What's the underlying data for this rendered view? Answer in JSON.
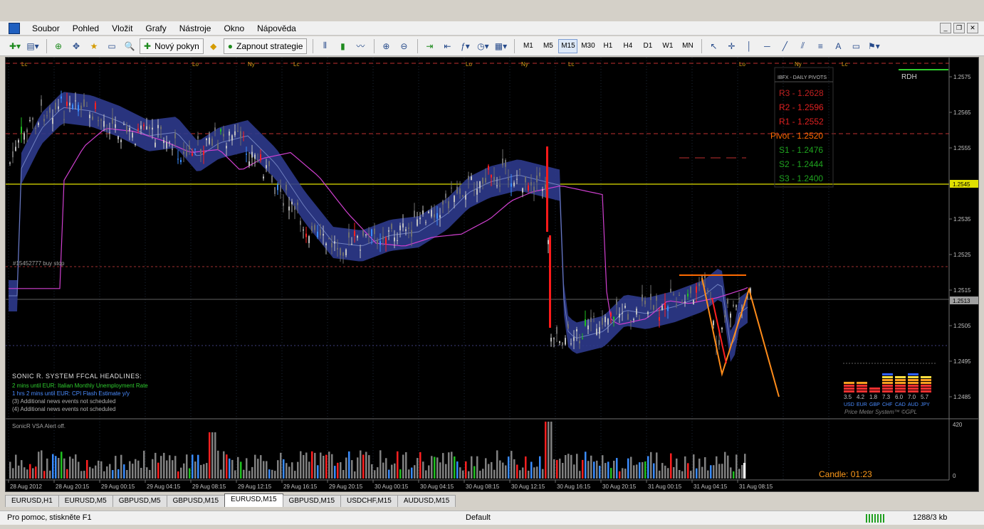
{
  "menu": {
    "items": [
      "Soubor",
      "Pohled",
      "Vložit",
      "Grafy",
      "Nástroje",
      "Okno",
      "Nápověda"
    ]
  },
  "toolbar": {
    "new_order_label": "Nový pokyn",
    "strategy_label": "Zapnout strategie",
    "timeframes": [
      "M1",
      "M5",
      "M15",
      "M30",
      "H1",
      "H4",
      "D1",
      "W1",
      "MN"
    ],
    "active_timeframe": "M15",
    "drawing_tools": [
      "A"
    ]
  },
  "chart": {
    "session_markers": [
      "Lc",
      "Lo",
      "Ny",
      "Lc",
      "Lo",
      "Ny",
      "Lc",
      "Lo",
      "Ny",
      "Lc"
    ],
    "order_label": "#15452777 buy stop",
    "current_price_line": "1.2545",
    "bid_price": "1.2513",
    "price_axis": [
      "1.2575",
      "1.2565",
      "1.2555",
      "1.2545",
      "1.2535",
      "1.2525",
      "1.2515",
      "1.2505",
      "1.2495",
      "1.2485"
    ],
    "time_axis": [
      "28 Aug 2012",
      "28 Aug 20:15",
      "29 Aug 00:15",
      "29 Aug 04:15",
      "29 Aug 08:15",
      "29 Aug 12:15",
      "29 Aug 16:15",
      "29 Aug 20:15",
      "30 Aug 00:15",
      "30 Aug 04:15",
      "30 Aug 08:15",
      "30 Aug 12:15",
      "30 Aug 16:15",
      "30 Aug 20:15",
      "31 Aug 00:15",
      "31 Aug 04:15",
      "31 Aug 08:15"
    ],
    "rdh_label": "RDH",
    "pivots_title": "IBFX - DAILY PIVOTS",
    "pivots": [
      {
        "label": "R3 - 1.2628",
        "color": "#c02020"
      },
      {
        "label": "R2 - 1.2596",
        "color": "#e02020"
      },
      {
        "label": "R1 - 1.2552",
        "color": "#e02020"
      },
      {
        "label": "Pivot - 1.2520",
        "color": "#ff6a00"
      },
      {
        "label": "S1 - 1.2476",
        "color": "#1fa31f"
      },
      {
        "label": "S2 - 1.2444",
        "color": "#1fa31f"
      },
      {
        "label": "S3 - 1.2400",
        "color": "#1fa31f"
      }
    ],
    "news_header": "SONIC R. SYSTEM  FFCAL HEADLINES:",
    "news": [
      {
        "text": "2 mins until EUR: Italian Monthly Unemployment Rate",
        "color": "#2ecc2e"
      },
      {
        "text": "1 hrs 2 mins until EUR: CPI Flash Estimate y/y",
        "color": "#4a8cff"
      },
      {
        "text": "(3)  Additional news events not scheduled",
        "color": "#b0b0b0"
      },
      {
        "text": "(4)  Additional news events not scheduled",
        "color": "#b0b0b0"
      }
    ],
    "price_meter": {
      "values": [
        "3.5",
        "4.2",
        "1.8",
        "7.3",
        "6.0",
        "7.0",
        "5.7"
      ],
      "currencies": [
        "USD",
        "EUR",
        "GBP",
        "CHF",
        "CAD",
        "AUD",
        "JPY"
      ],
      "caption": "Price Meter System™ ©GPL"
    }
  },
  "indicator": {
    "label": "SonicR VSA   Alert off.",
    "axis_top": "420",
    "axis_bottom": "0",
    "candle_timer": "Candle:  01:23"
  },
  "tabs": [
    "EURUSD,H1",
    "EURUSD,M5",
    "GBPUSD,M5",
    "GBPUSD,M15",
    "EURUSD,M15",
    "GBPUSD,M15",
    "USDCHF,M15",
    "AUDUSD,M15"
  ],
  "active_tab_index": 4,
  "status": {
    "help": "Pro pomoc, stiskněte F1",
    "profile": "Default",
    "traffic": "1288/3 kb"
  },
  "colors": {
    "chart_bg": "#000000",
    "bull": "#c0c0c0",
    "bear": "#6e6e6e",
    "band": "#3a4aa0",
    "ma": "#d040d0",
    "price_line": "#e0e000",
    "pattern": "#ff8c1a"
  }
}
